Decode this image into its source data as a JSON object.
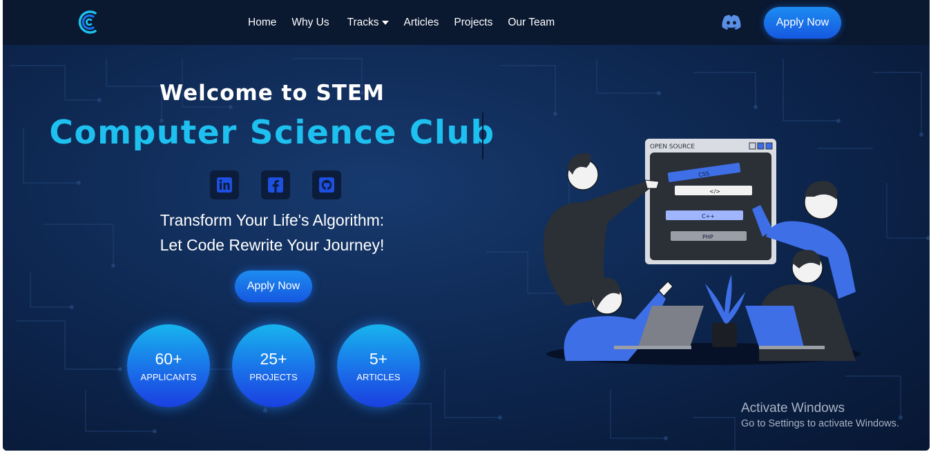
{
  "nav": {
    "links": [
      {
        "label": "Home"
      },
      {
        "label": "Why Us"
      },
      {
        "label": "Tracks"
      },
      {
        "label": "Articles"
      },
      {
        "label": "Projects"
      },
      {
        "label": "Our Team"
      }
    ],
    "apply_label": "Apply Now",
    "icons": {
      "logo": "club-logo",
      "discord": "discord-icon",
      "tracks_caret": "caret-down-icon"
    }
  },
  "hero": {
    "welcome": "Welcome to STEM",
    "club_name": "Computer Science Club",
    "social_icons": [
      "linkedin-icon",
      "facebook-icon",
      "github-icon"
    ],
    "tagline_line1": "Transform Your Life's Algorithm:",
    "tagline_line2": "Let Code Rewrite Your Journey!",
    "apply_label": "Apply Now",
    "stats": [
      {
        "value": "60+",
        "label": "APPLICANTS"
      },
      {
        "value": "25+",
        "label": "PROJECTS"
      },
      {
        "value": "5+",
        "label": "ARTICLES"
      }
    ],
    "illustration": {
      "window_title": "OPEN SOURCE",
      "code_labels": [
        "CSS",
        "</>",
        "C++",
        "PHP"
      ]
    }
  },
  "watermark": {
    "title": "Activate Windows",
    "subtitle": "Go to Settings to activate Windows."
  },
  "colors": {
    "accent": "#1ec0ef",
    "button": "#1a73ea",
    "background": "#0f2a55"
  }
}
